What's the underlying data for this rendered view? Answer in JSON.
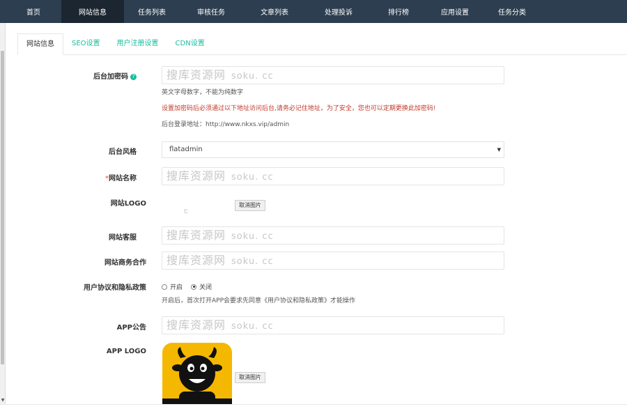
{
  "nav": {
    "items": [
      "首页",
      "网站信息",
      "任务列表",
      "审核任务",
      "文章列表",
      "处理投诉",
      "排行榜",
      "应用设置",
      "任务分类"
    ],
    "active_index": 1
  },
  "tabs": {
    "items": [
      "网站信息",
      "SEO设置",
      "用户注册设置",
      "CDN设置"
    ],
    "active_index": 0
  },
  "watermark": {
    "cn": "搜库资源网",
    "en": "soku. cc"
  },
  "form": {
    "admin_code": {
      "label": "后台加密码",
      "hint1": "英文字母数字，不能为纯数字",
      "hint2_warn": "设置加密码后必须通过以下地址访问后台,请务必记住地址，为了安全，您也可以定期更换此加密码!",
      "hint3": "后台登录地址：http://www.nkxs.vip/admin"
    },
    "theme": {
      "label": "后台风格",
      "value": "flatadmin"
    },
    "site_name": {
      "required_mark": "*",
      "label": "网站名称"
    },
    "site_logo": {
      "label": "网站LOGO",
      "button": "取消图片",
      "placeholder": "ඞ"
    },
    "customer_service": {
      "label": "网站客服"
    },
    "business": {
      "label": "网站商务合作"
    },
    "agreement": {
      "label": "用户协议和隐私政策",
      "options": [
        "开启",
        "关闭"
      ],
      "selected_index": 1,
      "hint": "开启后，首次打开APP会要求先同意《用户协议和隐私政策》才能操作"
    },
    "app_notice": {
      "label": "APP公告"
    },
    "app_logo": {
      "label": "APP LOGO",
      "button": "取消图片"
    }
  },
  "colors": {
    "nav_bg": "#2c3e50",
    "nav_active": "#1b2631",
    "accent": "#18bc9c",
    "warn": "#c0392b",
    "logo_bg": "#f5b800"
  },
  "icons": {
    "help": "question-circle-icon",
    "select_caret": "caret-down-icon",
    "scroll_down": "arrow-down-icon"
  }
}
